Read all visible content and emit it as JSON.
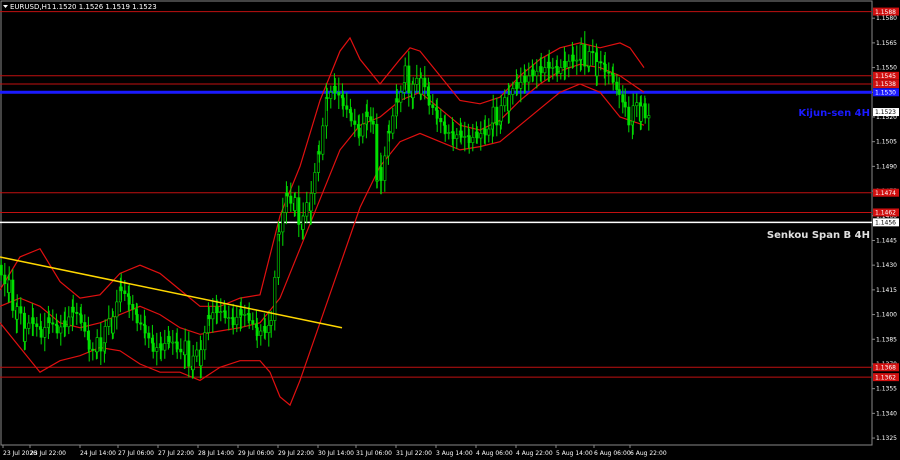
{
  "header": {
    "symbol_label": "EURUSD,H1",
    "ohlc_label": "1.1520 1.1526 1.1519 1.1523"
  },
  "price_axis": {
    "labels": [
      "1.1580",
      "1.1565",
      "1.1550",
      "1.1535",
      "1.1520",
      "1.1505",
      "1.1490",
      "1.1475",
      "1.1460",
      "1.1445",
      "1.1430",
      "1.1415",
      "1.1400",
      "1.1385",
      "1.1370",
      "1.1355",
      "1.1340",
      "1.1325"
    ],
    "range": [
      1.1322,
      1.1588
    ]
  },
  "time_axis": {
    "labels": [
      "23 Jul 2026",
      "23 Jul 22:00",
      "24 Jul 14:00",
      "27 Jul 06:00",
      "27 Jul 22:00",
      "28 Jul 14:00",
      "29 Jul 06:00",
      "29 Jul 22:00",
      "30 Jul 14:00",
      "31 Jul 06:00",
      "31 Jul 22:00",
      "3 Aug 14:00",
      "4 Aug 06:00",
      "4 Aug 22:00",
      "5 Aug 14:00",
      "6 Aug 06:00",
      "6 Aug 22:00"
    ]
  },
  "levels": {
    "red": [
      {
        "price": 1.1584,
        "tag": "1.1588"
      },
      {
        "price": 1.1545,
        "tag": "1.1545"
      },
      {
        "price": 1.154,
        "tag": "1.1538"
      },
      {
        "price": 1.1474,
        "tag": "1.1474"
      },
      {
        "price": 1.1462,
        "tag": "1.1462"
      },
      {
        "price": 1.1368,
        "tag": "1.1368"
      },
      {
        "price": 1.1362,
        "tag": "1.1362"
      }
    ],
    "kijun": {
      "price": 1.1535,
      "label": "Kijun-sen 4H",
      "tag": "1.1530"
    },
    "senkou": {
      "price": 1.1456,
      "label": "Senkou Span B 4H",
      "tag": "1.1456"
    },
    "current_price_tag": "1.1523"
  },
  "colors": {
    "candle": "#00e000",
    "band": "#e01010",
    "kijun": "#1a1aff",
    "senkou": "#ffffff",
    "trendline": "#ffd700",
    "level": "#c01010"
  },
  "chart_data": {
    "type": "candlestick",
    "symbol": "EURUSD",
    "timeframe": "H1",
    "close_path": [
      [
        0,
        1.143
      ],
      [
        8,
        1.1415
      ],
      [
        16,
        1.14
      ],
      [
        24,
        1.1388
      ],
      [
        32,
        1.1392
      ],
      [
        40,
        1.1385
      ],
      [
        48,
        1.1395
      ],
      [
        56,
        1.139
      ],
      [
        64,
        1.1395
      ],
      [
        72,
        1.1405
      ],
      [
        80,
        1.14
      ],
      [
        88,
        1.1385
      ],
      [
        96,
        1.138
      ],
      [
        104,
        1.1388
      ],
      [
        112,
        1.1395
      ],
      [
        120,
        1.1412
      ],
      [
        128,
        1.1405
      ],
      [
        136,
        1.1395
      ],
      [
        144,
        1.139
      ],
      [
        152,
        1.138
      ],
      [
        160,
        1.1382
      ],
      [
        168,
        1.1388
      ],
      [
        176,
        1.1385
      ],
      [
        184,
        1.1378
      ],
      [
        192,
        1.137
      ],
      [
        200,
        1.1375
      ],
      [
        208,
        1.1395
      ],
      [
        216,
        1.14
      ],
      [
        224,
        1.1398
      ],
      [
        232,
        1.1395
      ],
      [
        240,
        1.1402
      ],
      [
        248,
        1.14
      ],
      [
        256,
        1.1392
      ],
      [
        264,
        1.1395
      ],
      [
        270,
        1.14
      ],
      [
        278,
        1.1455
      ],
      [
        286,
        1.1478
      ],
      [
        294,
        1.1465
      ],
      [
        302,
        1.1455
      ],
      [
        310,
        1.147
      ],
      [
        318,
        1.1495
      ],
      [
        326,
        1.153
      ],
      [
        334,
        1.1535
      ],
      [
        342,
        1.1528
      ],
      [
        350,
        1.152
      ],
      [
        358,
        1.1512
      ],
      [
        366,
        1.1525
      ],
      [
        372,
        1.1518
      ],
      [
        376,
        1.1478
      ],
      [
        380,
        1.1485
      ],
      [
        388,
        1.1515
      ],
      [
        396,
        1.1535
      ],
      [
        404,
        1.1545
      ],
      [
        412,
        1.1535
      ],
      [
        420,
        1.154
      ],
      [
        428,
        1.1525
      ],
      [
        436,
        1.1518
      ],
      [
        444,
        1.151
      ],
      [
        452,
        1.1508
      ],
      [
        460,
        1.151
      ],
      [
        468,
        1.1508
      ],
      [
        476,
        1.1512
      ],
      [
        484,
        1.1515
      ],
      [
        492,
        1.152
      ],
      [
        500,
        1.1522
      ],
      [
        508,
        1.153
      ],
      [
        516,
        1.1535
      ],
      [
        524,
        1.154
      ],
      [
        532,
        1.1545
      ],
      [
        540,
        1.1548
      ],
      [
        548,
        1.1552
      ],
      [
        556,
        1.155
      ],
      [
        564,
        1.1555
      ],
      [
        572,
        1.156
      ],
      [
        580,
        1.1558
      ],
      [
        588,
        1.1555
      ],
      [
        596,
        1.155
      ],
      [
        604,
        1.1545
      ],
      [
        612,
        1.154
      ],
      [
        618,
        1.153
      ],
      [
        624,
        1.152
      ],
      [
        632,
        1.1522
      ],
      [
        640,
        1.1523
      ],
      [
        644,
        1.1523
      ]
    ],
    "trendline": {
      "from": [
        0,
        1.1435
      ],
      "to": [
        342,
        1.1392
      ]
    },
    "bands": {
      "upper": [
        [
          0,
          1.1415
        ],
        [
          20,
          1.1435
        ],
        [
          40,
          1.144
        ],
        [
          60,
          1.142
        ],
        [
          80,
          1.141
        ],
        [
          100,
          1.1412
        ],
        [
          120,
          1.1425
        ],
        [
          140,
          1.143
        ],
        [
          160,
          1.1425
        ],
        [
          180,
          1.1415
        ],
        [
          200,
          1.1405
        ],
        [
          220,
          1.1405
        ],
        [
          240,
          1.141
        ],
        [
          260,
          1.1412
        ],
        [
          280,
          1.146
        ],
        [
          300,
          1.149
        ],
        [
          320,
          1.153
        ],
        [
          340,
          1.156
        ],
        [
          350,
          1.1568
        ],
        [
          360,
          1.1555
        ],
        [
          380,
          1.154
        ],
        [
          400,
          1.1555
        ],
        [
          410,
          1.1562
        ],
        [
          420,
          1.156
        ],
        [
          440,
          1.1545
        ],
        [
          460,
          1.153
        ],
        [
          480,
          1.1528
        ],
        [
          500,
          1.1532
        ],
        [
          520,
          1.1545
        ],
        [
          540,
          1.1555
        ],
        [
          560,
          1.1562
        ],
        [
          580,
          1.1565
        ],
        [
          600,
          1.1562
        ],
        [
          620,
          1.1565
        ],
        [
          630,
          1.1562
        ],
        [
          644,
          1.155
        ]
      ],
      "middle": [
        [
          0,
          1.1405
        ],
        [
          20,
          1.141
        ],
        [
          40,
          1.1405
        ],
        [
          60,
          1.1395
        ],
        [
          80,
          1.1392
        ],
        [
          100,
          1.1395
        ],
        [
          120,
          1.14
        ],
        [
          140,
          1.1405
        ],
        [
          160,
          1.14
        ],
        [
          180,
          1.1392
        ],
        [
          200,
          1.1388
        ],
        [
          220,
          1.139
        ],
        [
          240,
          1.1392
        ],
        [
          260,
          1.1395
        ],
        [
          280,
          1.141
        ],
        [
          300,
          1.144
        ],
        [
          320,
          1.147
        ],
        [
          340,
          1.15
        ],
        [
          360,
          1.1515
        ],
        [
          380,
          1.152
        ],
        [
          400,
          1.153
        ],
        [
          420,
          1.1535
        ],
        [
          440,
          1.1525
        ],
        [
          460,
          1.1515
        ],
        [
          480,
          1.1512
        ],
        [
          500,
          1.1518
        ],
        [
          520,
          1.153
        ],
        [
          540,
          1.154
        ],
        [
          560,
          1.1548
        ],
        [
          580,
          1.1552
        ],
        [
          600,
          1.155
        ],
        [
          620,
          1.1545
        ],
        [
          644,
          1.1535
        ]
      ],
      "lower": [
        [
          0,
          1.1395
        ],
        [
          20,
          1.138
        ],
        [
          40,
          1.1365
        ],
        [
          60,
          1.1372
        ],
        [
          80,
          1.1375
        ],
        [
          100,
          1.138
        ],
        [
          120,
          1.1378
        ],
        [
          140,
          1.137
        ],
        [
          160,
          1.1365
        ],
        [
          180,
          1.1365
        ],
        [
          200,
          1.136
        ],
        [
          220,
          1.1368
        ],
        [
          240,
          1.1372
        ],
        [
          260,
          1.1372
        ],
        [
          270,
          1.1365
        ],
        [
          280,
          1.135
        ],
        [
          290,
          1.1345
        ],
        [
          300,
          1.136
        ],
        [
          320,
          1.1395
        ],
        [
          340,
          1.143
        ],
        [
          360,
          1.1465
        ],
        [
          380,
          1.149
        ],
        [
          400,
          1.1505
        ],
        [
          420,
          1.151
        ],
        [
          440,
          1.1505
        ],
        [
          460,
          1.15
        ],
        [
          480,
          1.1502
        ],
        [
          500,
          1.1505
        ],
        [
          520,
          1.1515
        ],
        [
          540,
          1.1525
        ],
        [
          560,
          1.1535
        ],
        [
          580,
          1.154
        ],
        [
          600,
          1.1535
        ],
        [
          620,
          1.152
        ],
        [
          644,
          1.1515
        ]
      ]
    }
  }
}
